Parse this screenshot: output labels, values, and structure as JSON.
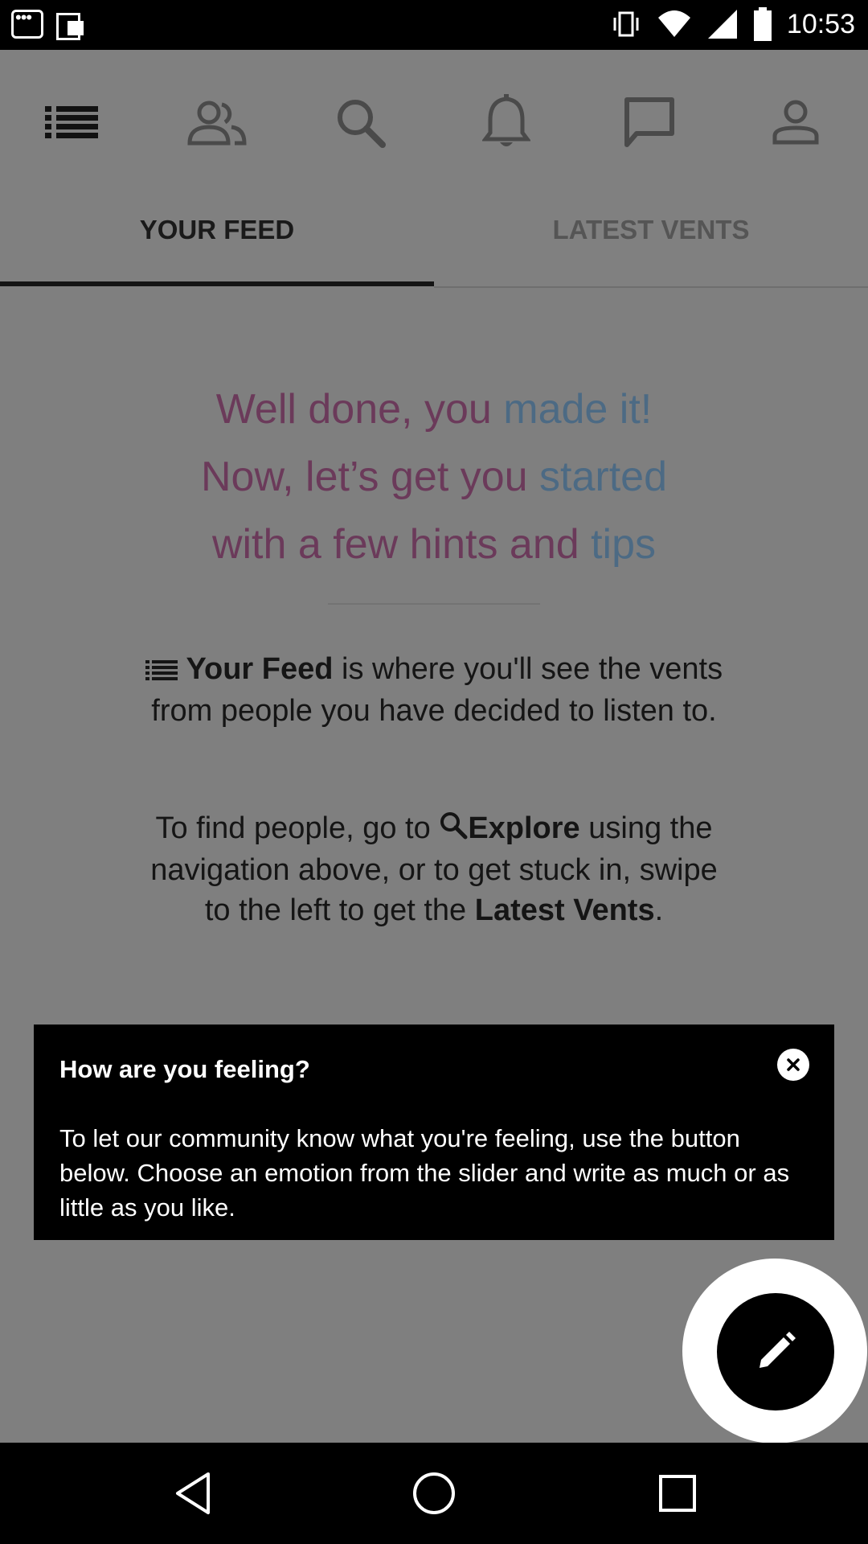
{
  "status_bar": {
    "time": "10:53",
    "icons": [
      "notification-dots-icon",
      "copy-icon",
      "vibrate-icon",
      "wifi-icon",
      "signal-icon",
      "battery-icon"
    ]
  },
  "nav": {
    "icons": [
      "menu-list-icon",
      "people-icon",
      "search-icon",
      "bell-icon",
      "chat-icon",
      "profile-icon"
    ]
  },
  "tabs": [
    {
      "label": "YOUR FEED",
      "selected": true
    },
    {
      "label": "LATEST VENTS",
      "selected": false
    }
  ],
  "hero": {
    "line1_a": "Well done, you ",
    "line1_b": "made it!",
    "line2_a": "Now, let’s get you ",
    "line2_b": "started",
    "line3_a": "with a few hints and ",
    "line3_b": "tips"
  },
  "tips": {
    "tip1_bold": "Your Feed",
    "tip1_rest": " is where you'll see the vents from people you have decided to listen to.",
    "tip2_pre": "To find people, go to ",
    "tip2_bold": "Explore",
    "tip2_mid": " using the navigation above, or to get stuck in, swipe to the left to get the ",
    "tip2_bold2": "Latest Vents",
    "tip2_end": "."
  },
  "popup": {
    "title": "How are you feeling?",
    "body": "To let our community know what you're feeling, use the button below. Choose an emotion from the slider and write as much or as little as you like."
  },
  "fab": {
    "icon": "pencil-icon"
  },
  "system_nav": {
    "icons": [
      "back-icon",
      "home-icon",
      "recents-icon"
    ]
  },
  "colors": {
    "overlay_gray": "#7f7f7f",
    "hero_pink": "#6b3a5a",
    "hero_blue": "#4c6a84",
    "popup_bg": "#000000"
  }
}
